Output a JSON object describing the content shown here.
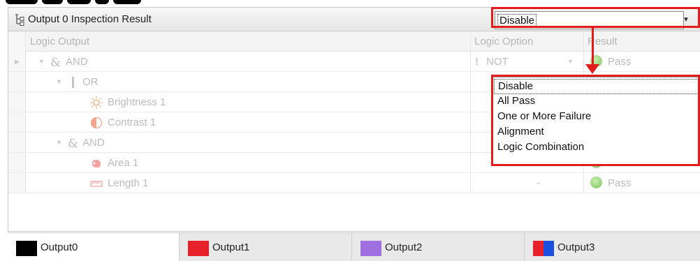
{
  "panel": {
    "title": "Output 0 Inspection Result",
    "mode_select": {
      "value": "Disable",
      "arrow": "▼"
    }
  },
  "columns": [
    "Logic Output",
    "Logic Option",
    "Result"
  ],
  "rows": [
    {
      "label": "AND",
      "icon": "and-icon",
      "option": "NOT",
      "option_icon": "!",
      "result": "Pass"
    },
    {
      "label": "OR",
      "icon": "or-icon",
      "option": "",
      "result": ""
    },
    {
      "label": "Brightness 1",
      "icon": "brightness-icon",
      "option": "",
      "result": ""
    },
    {
      "label": "Contrast 1",
      "icon": "contrast-icon",
      "option": "",
      "result": ""
    },
    {
      "label": "AND",
      "icon": "and-icon",
      "option": "",
      "result": ""
    },
    {
      "label": "Area 1",
      "icon": "area-icon",
      "option": "-",
      "result": "Pass"
    },
    {
      "label": "Length 1",
      "icon": "length-icon",
      "option": "-",
      "result": "Pass"
    }
  ],
  "dropdown_options": [
    "Disable",
    "All Pass",
    "One or More Failure",
    "Alignment",
    "Logic Combination"
  ],
  "tabs": [
    {
      "label": "Output0",
      "color": "#000000"
    },
    {
      "label": "Output1",
      "color": "#e8202a"
    },
    {
      "label": "Output2",
      "color": "#a070e0"
    },
    {
      "label": "Output3",
      "color": "#e8202a",
      "color2": "#1a4fe0"
    }
  ],
  "accent": "#e41b1b"
}
